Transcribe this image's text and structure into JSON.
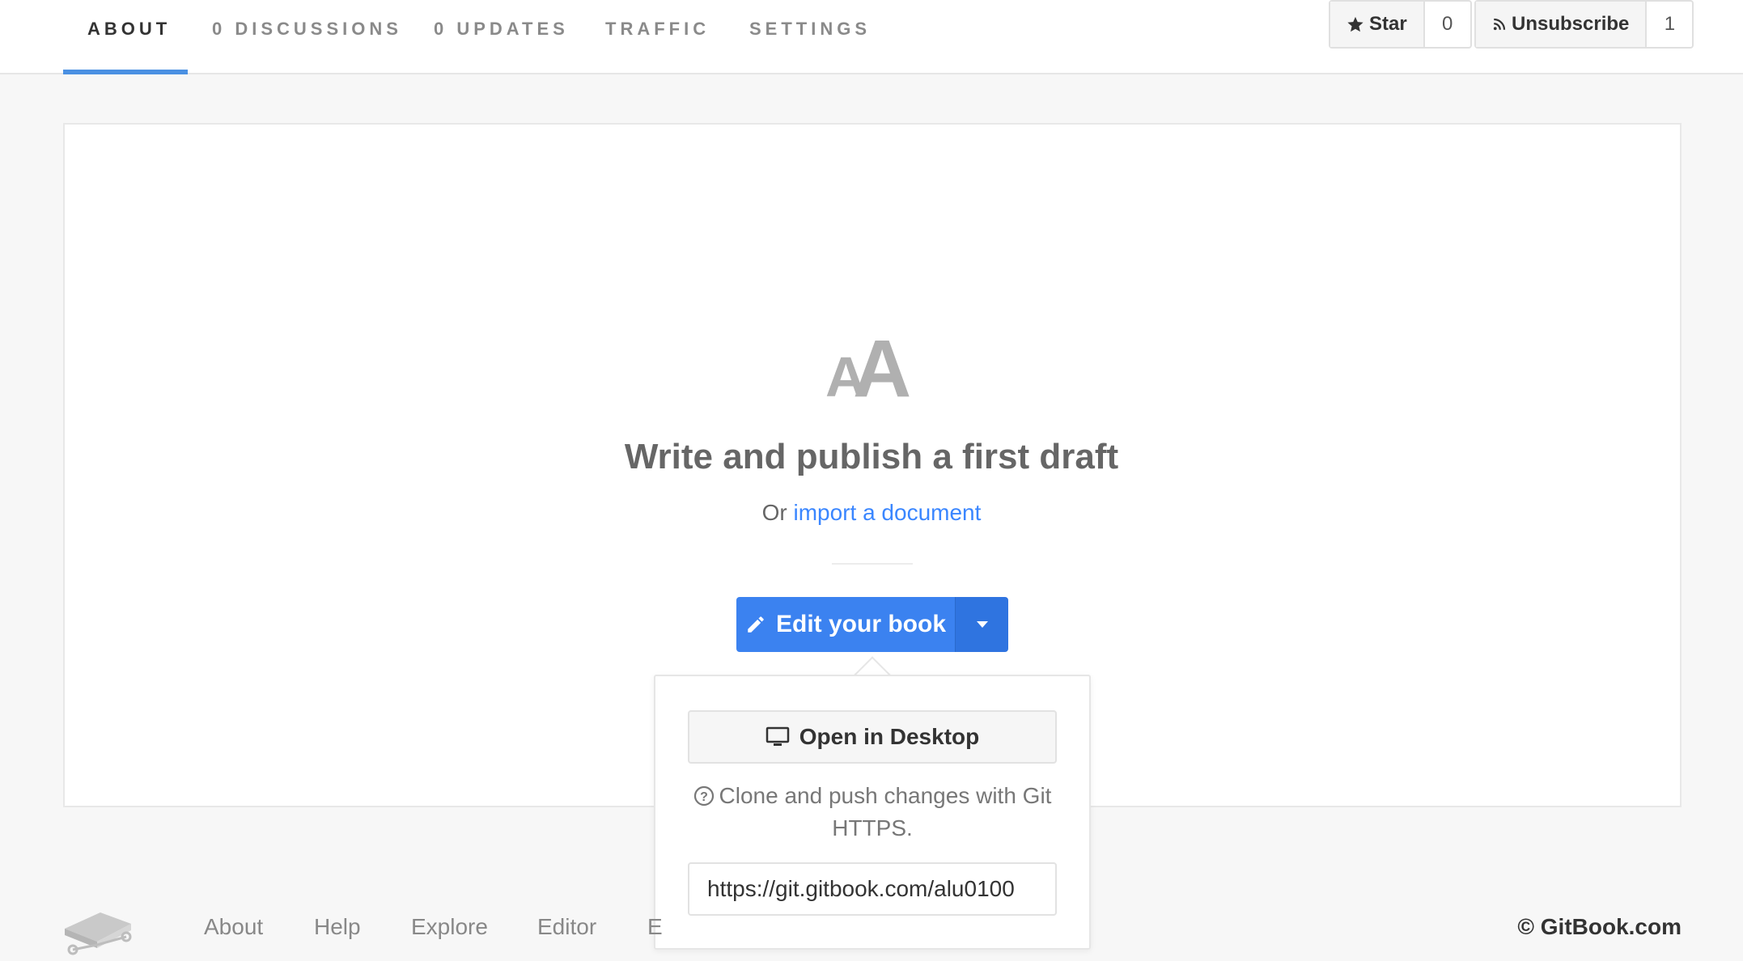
{
  "nav": {
    "tabs": [
      {
        "label": "ABOUT"
      },
      {
        "label": "0 DISCUSSIONS"
      },
      {
        "label": "0 UPDATES"
      },
      {
        "label": "TRAFFIC"
      },
      {
        "label": "SETTINGS"
      }
    ],
    "active_tab": "ABOUT",
    "star": {
      "label": "Star",
      "count": "0"
    },
    "unsubscribe": {
      "label": "Unsubscribe",
      "count": "1"
    }
  },
  "hero": {
    "logo_text": "AA",
    "headline": "Write and publish a first draft",
    "sub_prefix": "Or",
    "sub_link": "import a document"
  },
  "edit": {
    "label": "Edit your book"
  },
  "popover": {
    "open_desktop_label": "Open in Desktop",
    "help_text": "Clone and push changes with Git HTTPS.",
    "git_url": "https://git.gitbook.com/alu0100"
  },
  "footer": {
    "links": [
      {
        "label": "About"
      },
      {
        "label": "Help"
      },
      {
        "label": "Explore"
      },
      {
        "label": "Editor"
      },
      {
        "label": "E"
      }
    ],
    "copyright": "© GitBook.com"
  },
  "colors": {
    "accent": "#3b82f0",
    "link": "#3a86ff",
    "tab_underline": "#4a90e2"
  }
}
